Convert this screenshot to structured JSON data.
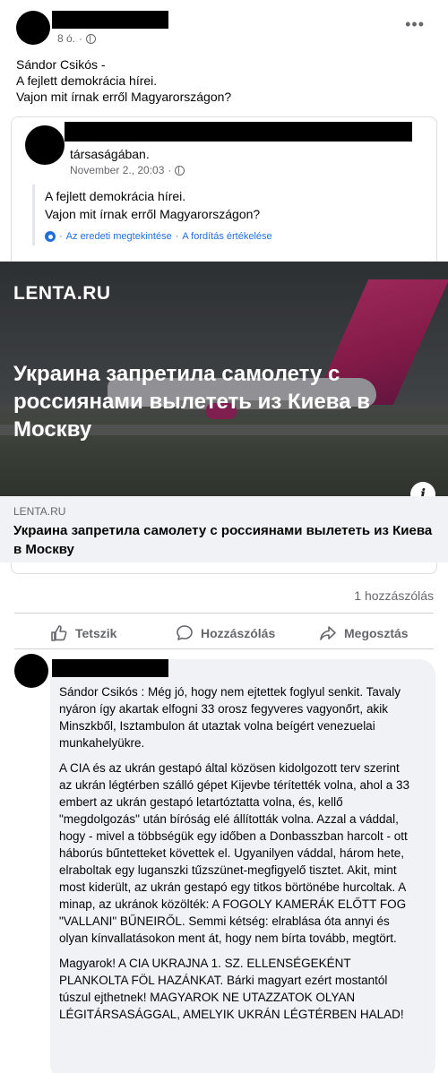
{
  "post": {
    "timestamp": "8 ó.",
    "text_lines": [
      "Sándor Csikós -",
      "A fejlett demokrácia hírei.",
      "Vajon mit írnak erről Magyarországon?"
    ]
  },
  "shared": {
    "author_suffix": "társaságában.",
    "timestamp": "November 2., 20:03",
    "quote_lines": [
      "A fejlett demokrácia hírei.",
      "Vajon mit írnak erről Magyarországon?"
    ],
    "see_original": "Az eredeti megtekintése",
    "rate_translation": "A fordítás értékelése",
    "separator": "·"
  },
  "link": {
    "image_brand": "LENTA.RU",
    "image_headline": "Украина запретила самолету с россиянами вылететь из Киева в Москву",
    "domain": "LENTA.RU",
    "title": "Украина запретила самолету с россиянами вылететь из Киева в Москву"
  },
  "stats": {
    "comments": "1 hozzászólás"
  },
  "actions": {
    "like": "Tetszik",
    "comment": "Hozzászólás",
    "share": "Megosztás"
  },
  "comment": {
    "paragraphs": [
      "Sándor Csikós : Még jó, hogy nem ejtettek foglyul senkit. Tavaly nyáron így akartak elfogni 33 orosz fegyveres vagyonőrt, akik Minszkből, Isztambulon át utaztak volna beígért venezuelai munkahelyükre.",
      "A CIA és az ukrán gestapó által közösen kidolgozott terv szerint az ukrán légtérben szálló gépet Kijevbe térítették volna, ahol a 33 embert az ukrán gestapó letartóztatta volna, és, kellő \"megdolgozás\" után bíróság elé állították volna. Azzal a váddal, hogy - mivel a többségük egy időben a Donbasszban harcolt - ott háborús bűntetteket követtek el. Ugyanilyen váddal, három hete, elraboltak egy luganszki tűzszünet-megfigyelő tisztet. Akit, mint most kiderült, az ukrán gestapó egy titkos börtönébe hurcoltak. A minap, az ukránok közölték: A FOGOLY KAMERÁK ELŐTT FOG \"VALLANI\" BŰNEIRŐL. Semmi kétség: elrablása óta annyi és olyan kínvallatásokon ment át, hogy nem bírta tovább, megtört.",
      "Magyarok! A CIA UKRAJNA 1. SZ. ELLENSÉGEKÉNT PLANKOLTA FÖL HAZÁNKAT. Bárki magyart ezért mostantól túszul ejthetnek! MAGYAROK NE UTAZZATOK OLYAN LÉGITÁRSASÁGGAL, AMELYIK UKRÁN LÉGTÉRBEN HALAD!"
    ]
  },
  "colors": {
    "link_blue": "#216fdb",
    "muted": "#65676b",
    "bubble_bg": "#f0f2f5",
    "wizz_pink": "#c62f72"
  },
  "icons": [
    "globe-icon",
    "more-options-icon",
    "gear-icon",
    "info-icon",
    "like-icon",
    "comment-icon",
    "share-icon"
  ]
}
